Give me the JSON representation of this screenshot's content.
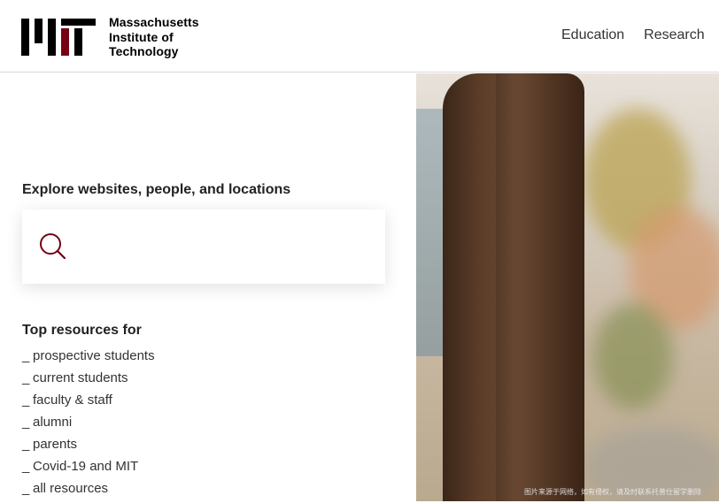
{
  "header": {
    "logo": {
      "line1": "Massachusetts",
      "line2": "Institute of",
      "line3": "Technology"
    },
    "nav": [
      {
        "label": "Education"
      },
      {
        "label": "Research"
      }
    ]
  },
  "search": {
    "label": "Explore websites, people, and locations",
    "value": "",
    "placeholder": ""
  },
  "resources": {
    "title": "Top resources for",
    "items": [
      {
        "label": "prospective students"
      },
      {
        "label": "current students"
      },
      {
        "label": "faculty & staff"
      },
      {
        "label": "alumni"
      },
      {
        "label": "parents"
      },
      {
        "label": "Covid-19 and MIT"
      },
      {
        "label": "all resources"
      }
    ]
  },
  "photo": {
    "watermark": "图片来源于网络，如有侵权，请及时联系托普仕留学删除"
  },
  "colors": {
    "accent": "#750014",
    "logo_black": "#000000"
  }
}
